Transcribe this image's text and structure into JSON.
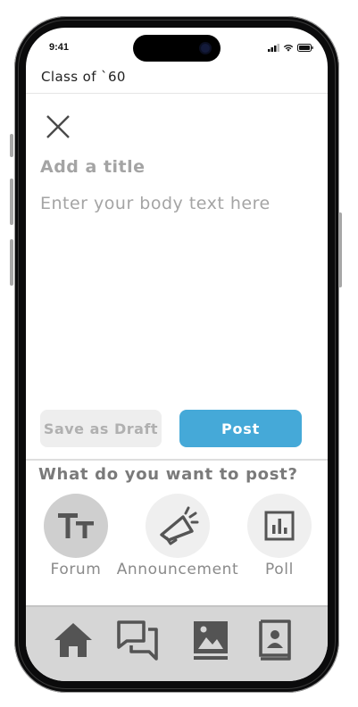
{
  "status_bar": {
    "time": "9:41"
  },
  "header": {
    "app_title": "Class of `60"
  },
  "composer": {
    "title_placeholder": "Add a title",
    "body_placeholder": "Enter your body text here",
    "draft_label": "Save as Draft",
    "post_label": "Post"
  },
  "post_types": {
    "question": "What do you want to post?",
    "options": [
      {
        "label": "Forum",
        "icon": "text-size-icon",
        "selected": true
      },
      {
        "label": "Announcement",
        "icon": "megaphone-icon",
        "selected": false
      },
      {
        "label": "Poll",
        "icon": "bar-chart-icon",
        "selected": false
      }
    ]
  },
  "tabbar": {
    "items": [
      {
        "icon": "home-icon"
      },
      {
        "icon": "chat-icon"
      },
      {
        "icon": "gallery-icon"
      },
      {
        "icon": "directory-icon"
      }
    ]
  },
  "colors": {
    "accent": "#45a9d8",
    "placeholder_text": "#a4a4a4",
    "tabbar_bg": "#d6d6d6",
    "tabbar_icon": "#545454",
    "selected_type_bg": "#cfcfcf"
  }
}
